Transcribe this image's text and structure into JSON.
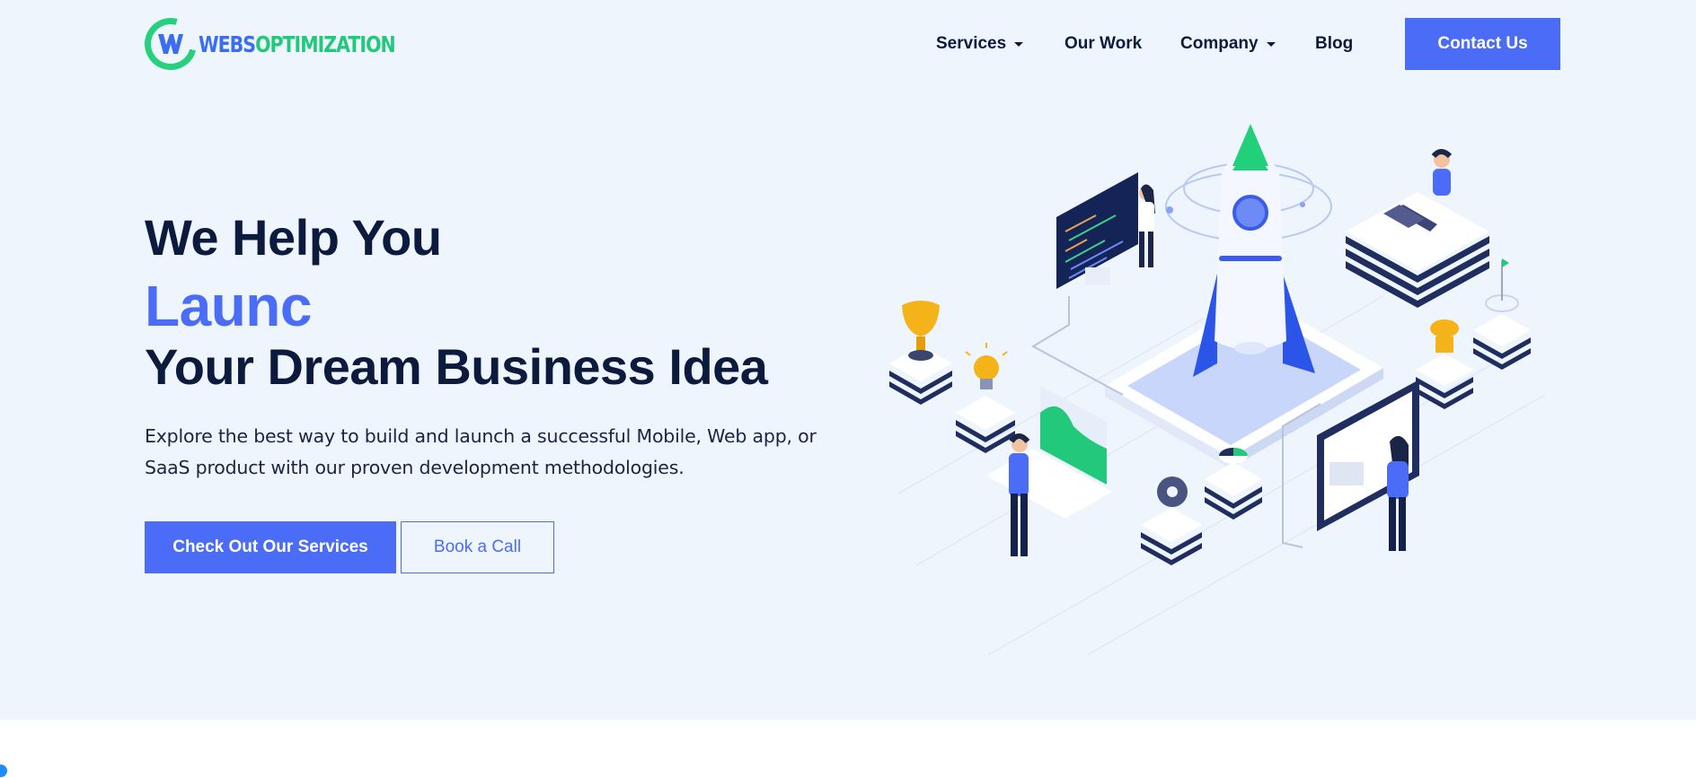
{
  "header": {
    "logo": {
      "part1": "WEBS",
      "part2": "OPTIMIZATION"
    },
    "nav": [
      {
        "label": "Services",
        "dropdown": true
      },
      {
        "label": "Our Work",
        "dropdown": false
      },
      {
        "label": "Company",
        "dropdown": true
      },
      {
        "label": "Blog",
        "dropdown": false
      }
    ],
    "contact_label": "Contact Us"
  },
  "hero": {
    "line1": "We Help You",
    "line2": "Launc",
    "line3": "Your Dream Business Idea",
    "lead": "Explore the best way to build and launch a successful Mobile, Web app, or SaaS product with our proven development methodologies.",
    "primary_cta": "Check Out Our Services",
    "secondary_cta": "Book a Call"
  },
  "colors": {
    "accent": "#4a6cf7",
    "navy": "#0c1a3d",
    "logo_green": "#22c97a",
    "hero_bg": "#eff5fd"
  },
  "illustration": {
    "subject": "isometric rocket launch with team working"
  }
}
